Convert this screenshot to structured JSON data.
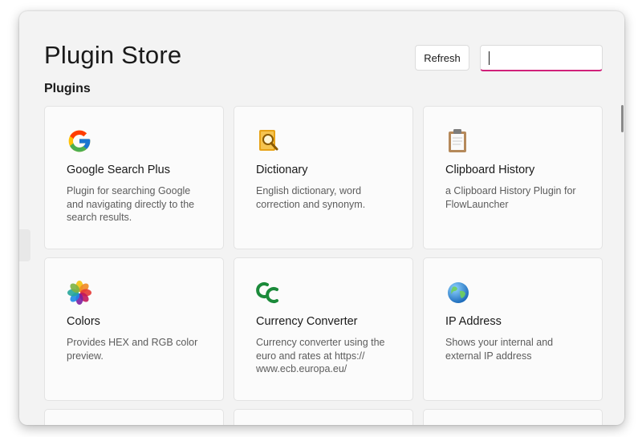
{
  "header": {
    "title": "Plugin Store",
    "refresh_label": "Refresh",
    "search_value": "",
    "search_placeholder": ""
  },
  "section_title": "Plugins",
  "colors": {
    "accent": "#d1207a",
    "window_bg": "#f3f3f3",
    "card_bg": "#fbfbfb"
  },
  "plugins": [
    {
      "name": "Google Search Plus",
      "description": "Plugin for searching Google and navigating directly to the search results.",
      "icon": "google-logo-icon"
    },
    {
      "name": "Dictionary",
      "description": "English dictionary, word correction and synonym.",
      "icon": "dictionary-icon"
    },
    {
      "name": "Clipboard History",
      "description": "a Clipboard History Plugin for FlowLauncher",
      "icon": "clipboard-icon"
    },
    {
      "name": "Colors",
      "description": "Provides HEX and RGB color preview.",
      "icon": "color-flower-icon"
    },
    {
      "name": "Currency Converter",
      "description": "Currency converter using the euro and rates at https:// www.ecb.europa.eu/",
      "icon": "currency-cc-icon"
    },
    {
      "name": "IP Address",
      "description": "Shows your internal and external IP address",
      "icon": "globe-icon"
    }
  ]
}
